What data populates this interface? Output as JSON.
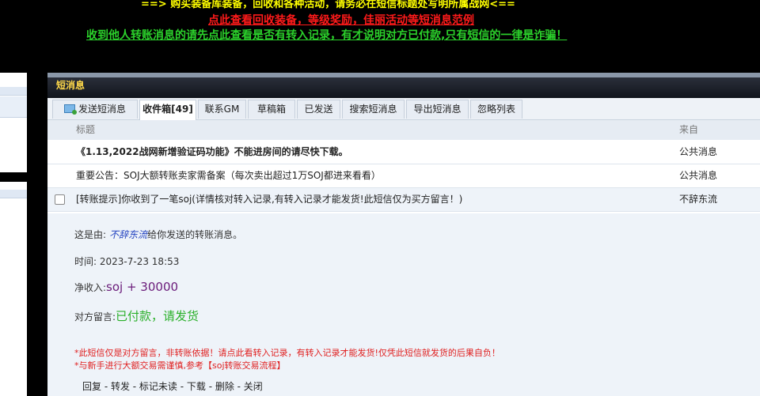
{
  "banner": {
    "line1": "==> 购买装备库装备，回收和各种活动，请务必在短信标题处写明所属战网<==",
    "line2": "点此查看回收装备，等级奖励，佳丽活动等短消息范例",
    "line3": "收到他人转账消息的请先点此查看是否有转入记录，有才说明对方已付款,只有短信的一律是诈骗！"
  },
  "panel": {
    "title": "短消息"
  },
  "tabs": [
    {
      "label": "发送短消息",
      "icon": "compose-icon"
    },
    {
      "label": "收件箱[49]"
    },
    {
      "label": "联系GM"
    },
    {
      "label": "草稿箱"
    },
    {
      "label": "已发送"
    },
    {
      "label": "搜索短消息"
    },
    {
      "label": "导出短消息"
    },
    {
      "label": "忽略列表"
    }
  ],
  "table": {
    "col_subject": "标题",
    "col_from": "来自",
    "rows": [
      {
        "subject": "《1.13,2022战网新增验证码功能》不能进房间的请尽快下载。",
        "from": "公共消息"
      },
      {
        "subject": "重要公告：SOJ大额转账卖家需备案（每次卖出超过1万SOJ都进来看看）",
        "from": "公共消息"
      },
      {
        "subject": "[转账提示]你收到了一笔soj(详情核对转入记录,有转入记录才能发货!此短信仅为买方留言！)",
        "from": "不辞东流"
      }
    ]
  },
  "detail": {
    "from_prefix": "这是由:",
    "from_user": "不辞东流",
    "from_suffix": "给你发送的转账消息。",
    "time_label": "时间:",
    "time_value": "2023-7-23 18:53",
    "income_label": "净收入:",
    "income_value": "soj + 30000",
    "note_label": "对方留言:",
    "note_value": "已付款，请发货",
    "warn1": "*此短信仅是对方留言，非转账依据！请点此看转入记录，有转入记录才能发货!仅凭此短信就发货的后果自负！",
    "warn2": "*与新手进行大额交易需谨慎,参考【soj转账交易流程】",
    "actions": "回复 - 转发 - 标记未读 - 下载 - 删除 - 关闭"
  },
  "colors": {
    "banner_yellow": "#ffff00",
    "banner_red": "#ff1a1a",
    "banner_green": "#2bd12b",
    "title_gold": "#ffd94a"
  }
}
